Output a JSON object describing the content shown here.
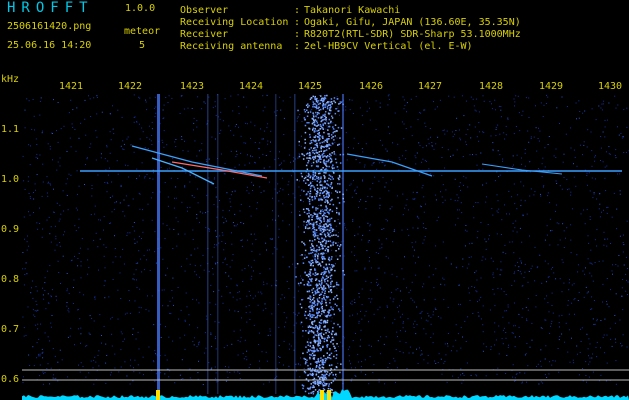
{
  "app": {
    "title": "HROFFT",
    "version": "1.0.0"
  },
  "capture": {
    "file_name": "2506161420.png",
    "datetime": "25.06.16 14:20"
  },
  "detection": {
    "label": "meteor",
    "count": "5"
  },
  "info": [
    {
      "key": "Observer",
      "value": "Takanori Kawachi"
    },
    {
      "key": "Receiving Location",
      "value": "Ogaki, Gifu, JAPAN (136.60E, 35.35N)"
    },
    {
      "key": "Receiver",
      "value": "R820T2(RTL-SDR) SDR-Sharp 53.1000MHz"
    },
    {
      "key": "Receiving antenna",
      "value": "2el-HB9CV Vertical (el. E-W)"
    }
  ],
  "info_separator": ":",
  "axes": {
    "y_unit": "kHz",
    "x_ticks": [
      "1421",
      "1422",
      "1423",
      "1424",
      "1425",
      "1426",
      "1427",
      "1428",
      "1429",
      "1430"
    ],
    "y_ticks": [
      "1.1",
      "1.0",
      "0.9",
      "0.8",
      "0.7",
      "0.6"
    ]
  },
  "colors": {
    "background": "#000000",
    "text": "#d8d000",
    "title": "#00c8e6",
    "noise": "#1530a0",
    "signal": "#3aa0ff",
    "baseline_trace": "#00d8ff",
    "marker_yellow": "#ffe000"
  }
}
